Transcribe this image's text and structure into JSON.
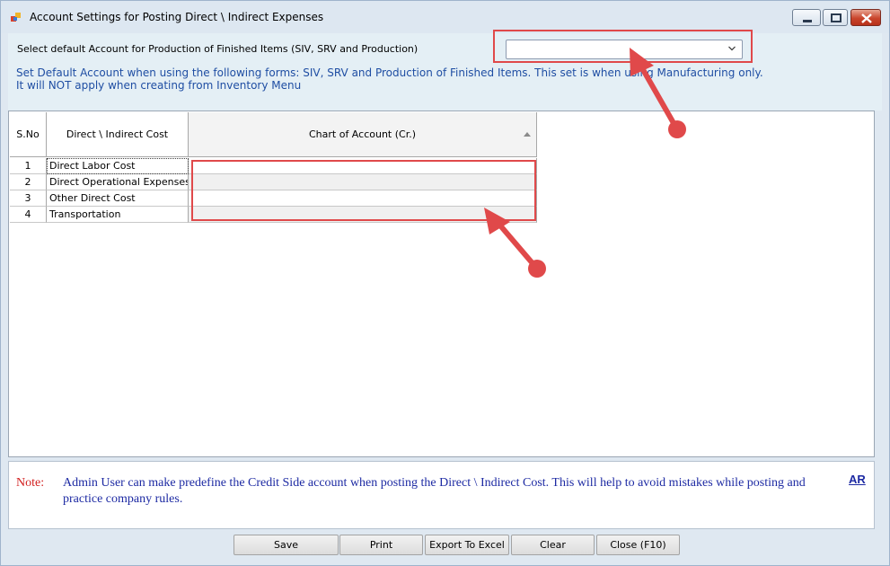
{
  "window": {
    "title": "Account Settings for Posting Direct \\ Indirect Expenses",
    "icon": "app-icon"
  },
  "header": {
    "default_account_label": "Select default Account for Production of Finished Items (SIV, SRV and Production)",
    "default_account_value": "",
    "info_line_1": "Set Default Account when using the following forms: SIV, SRV and Production of Finished Items. This set is when using Manufacturing only.",
    "info_line_2": "It will NOT apply when creating from Inventory Menu"
  },
  "grid": {
    "columns": [
      "S.No",
      "Direct \\ Indirect Cost",
      "Chart of Account (Cr.)"
    ],
    "rows": [
      {
        "sno": "1",
        "cost": "Direct Labor Cost",
        "account": ""
      },
      {
        "sno": "2",
        "cost": "Direct Operational Expenses",
        "account": ""
      },
      {
        "sno": "3",
        "cost": "Other Direct Cost",
        "account": ""
      },
      {
        "sno": "4",
        "cost": "Transportation",
        "account": ""
      }
    ]
  },
  "note": {
    "label": "Note:",
    "text": "Admin User can make predefine the Credit Side account when posting the Direct \\ Indirect Cost. This will help to avoid mistakes while posting and practice company rules.",
    "link": "AR"
  },
  "buttons": {
    "save": "Save",
    "print": "Print",
    "export": "Export To Excel",
    "clear": "Clear",
    "close": "Close (F10)"
  },
  "colors": {
    "info_text": "#1f4ea3",
    "note_label": "#d21f1f",
    "note_text": "#1d2aa3",
    "annotation": "#e0494a"
  }
}
